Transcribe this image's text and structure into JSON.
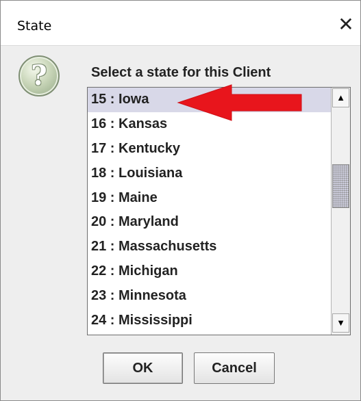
{
  "window": {
    "title": "State",
    "close_glyph": "✕"
  },
  "dialog": {
    "icon": "question-icon",
    "icon_glyph": "?",
    "prompt": "Select a state for this Client",
    "selected": "15 : Iowa",
    "items": [
      {
        "label": "15 : Iowa"
      },
      {
        "label": "16 : Kansas"
      },
      {
        "label": "17 : Kentucky"
      },
      {
        "label": "18 : Louisiana"
      },
      {
        "label": "19 : Maine"
      },
      {
        "label": "20 : Maryland"
      },
      {
        "label": "21 : Massachusetts"
      },
      {
        "label": "22 : Michigan"
      },
      {
        "label": "23 : Minnesota"
      },
      {
        "label": "24 : Mississippi"
      }
    ],
    "scroll": {
      "up_glyph": "▲",
      "down_glyph": "▼"
    }
  },
  "buttons": {
    "ok": "OK",
    "cancel": "Cancel"
  },
  "annotation": {
    "type": "red-arrow",
    "color": "#e8151c",
    "points_to": "15 : Iowa"
  }
}
